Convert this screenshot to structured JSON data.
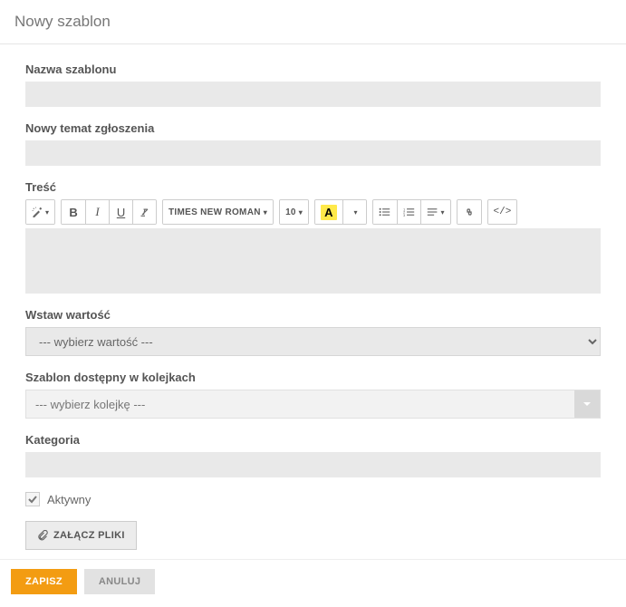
{
  "header": {
    "title": "Nowy szablon"
  },
  "fields": {
    "name_label": "Nazwa szablonu",
    "name_value": "",
    "subject_label": "Nowy temat zgłoszenia",
    "subject_value": "",
    "content_label": "Treść",
    "insert_value_label": "Wstaw wartość",
    "insert_value_placeholder": "--- wybierz wartość ---",
    "queue_label": "Szablon dostępny w kolejkach",
    "queue_placeholder": "--- wybierz kolejkę ---",
    "category_label": "Kategoria",
    "category_value": "",
    "active_label": "Aktywny",
    "attach_label": "ZAŁĄCZ PLIKI"
  },
  "toolbar": {
    "font_family": "TIMES NEW ROMAN",
    "font_size": "10"
  },
  "footer": {
    "save": "ZAPISZ",
    "cancel": "ANULUJ"
  }
}
